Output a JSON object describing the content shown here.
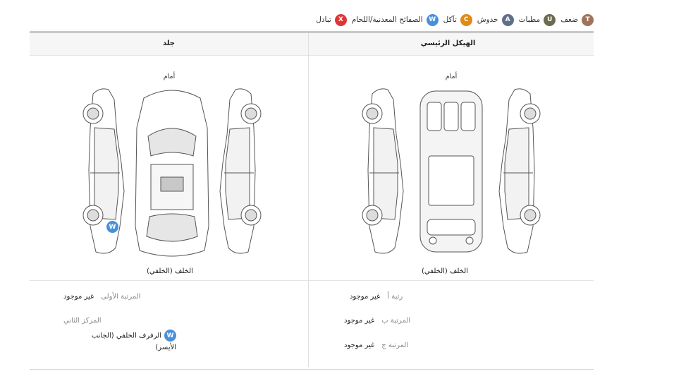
{
  "legend": {
    "items": [
      {
        "letter": "T",
        "label": "ضعف",
        "color": "#a1735c"
      },
      {
        "letter": "U",
        "label": "مطبات",
        "color": "#6b6b4e"
      },
      {
        "letter": "A",
        "label": "خدوش",
        "color": "#5f6f8a"
      },
      {
        "letter": "C",
        "label": "تآكل",
        "color": "#e08a16"
      },
      {
        "letter": "W",
        "label": "الصفائح المعدنية/اللحام",
        "color": "#4a90d9"
      },
      {
        "letter": "X",
        "label": "تبادل",
        "color": "#e03535"
      }
    ]
  },
  "frame": {
    "title": "الهيكل الرئيسي",
    "front_label": "أمام",
    "rear_label": "الخلف (الخلفي)",
    "rows": [
      {
        "label": "رتبة أ",
        "value": "غير موجود"
      },
      {
        "label": "المرتبة ب",
        "value": "غير موجود"
      },
      {
        "label": "المرتبة ج",
        "value": "غير موجود"
      }
    ]
  },
  "skin": {
    "title": "جلد",
    "front_label": "أمام",
    "rear_label": "الخلف (الخلفي)",
    "marker": {
      "letter": "W",
      "color": "#4a90d9"
    },
    "rows": [
      {
        "label": "المرتبة الأولى",
        "value": "غير موجود"
      }
    ],
    "second": {
      "label": "المركز الثاني",
      "item": {
        "letter": "W",
        "color": "#4a90d9",
        "text": "الرفرف الخلفي (الجانب الأيسر)"
      }
    }
  }
}
